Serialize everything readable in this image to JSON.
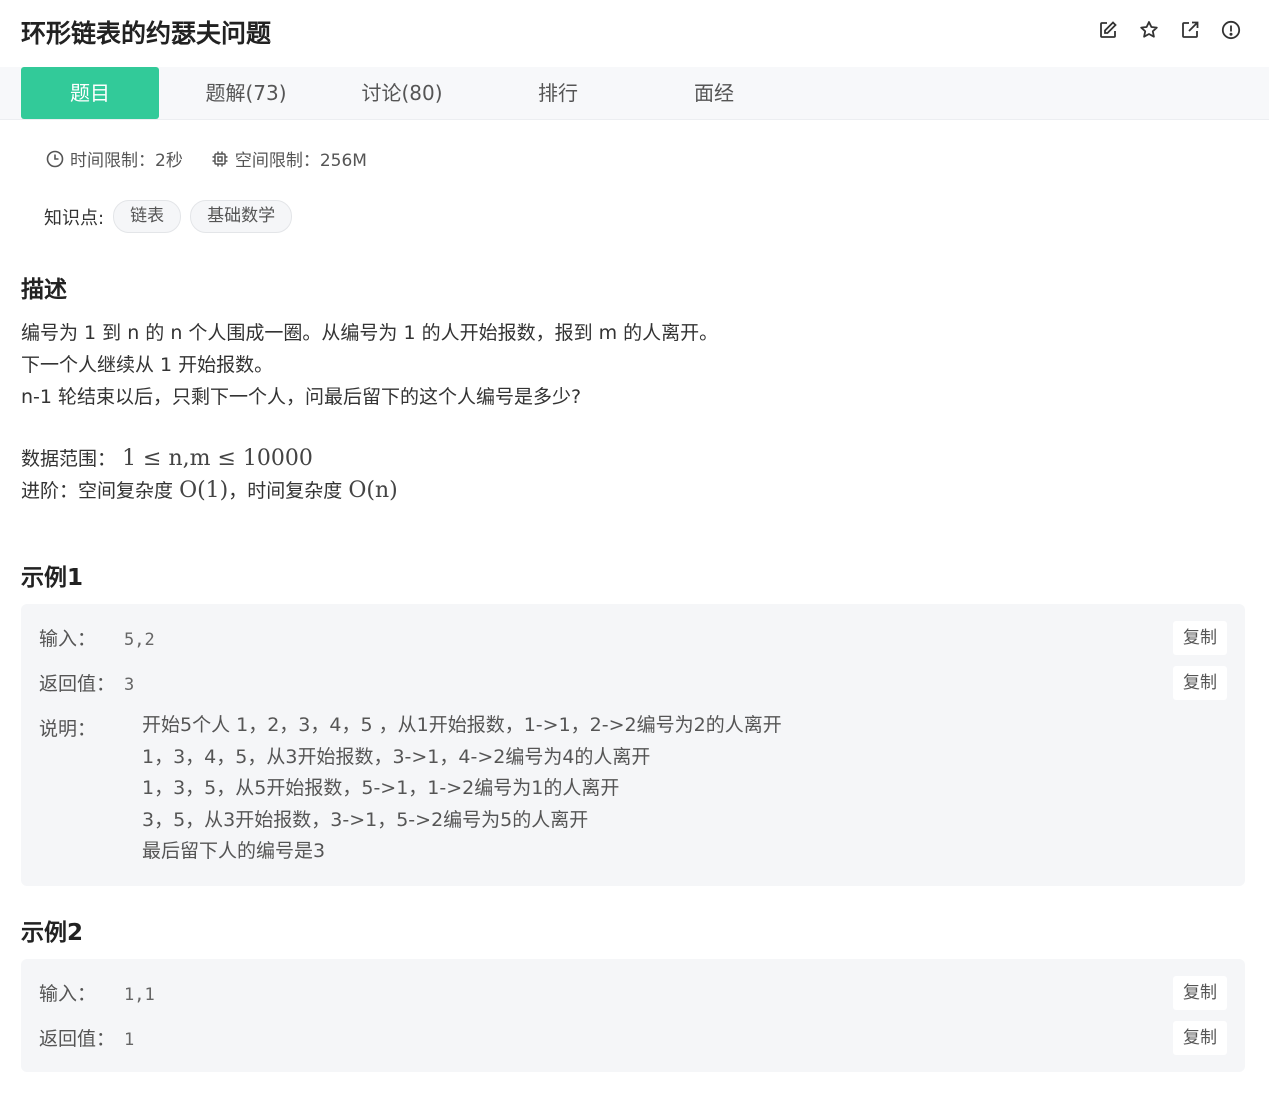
{
  "title": "环形链表的约瑟夫问题",
  "icons": [
    "edit-icon",
    "star-icon",
    "external-link-icon",
    "report-icon"
  ],
  "tabs": [
    {
      "label": "题目",
      "active": true
    },
    {
      "label": "题解(73)",
      "active": false
    },
    {
      "label": "讨论(80)",
      "active": false
    },
    {
      "label": "排行",
      "active": false
    },
    {
      "label": "面经",
      "active": false
    }
  ],
  "limits": {
    "time": "时间限制：2秒",
    "memory": "空间限制：256M"
  },
  "knowledge": {
    "label": "知识点:",
    "tags": [
      "链表",
      "基础数学"
    ]
  },
  "description": {
    "heading": "描述",
    "lines": [
      "编号为 1 到 n 的 n 个人围成一圈。从编号为 1 的人开始报数，报到 m 的人离开。",
      "下一个人继续从 1 开始报数。",
      "n-1 轮结束以后，只剩下一个人，问最后留下的这个人编号是多少?"
    ],
    "range_label": "数据范围：",
    "range_math": "1 ≤ n,m ≤ 10000",
    "advance_label": "进阶：空间复杂度",
    "advance_space": "O(1)",
    "advance_mid": "，时间复杂度",
    "advance_time": "O(n)"
  },
  "examples": [
    {
      "heading": "示例1",
      "input_label": "输入：",
      "input": "5,2",
      "return_label": "返回值：",
      "return": "3",
      "explain_label": "说明：",
      "explain": [
        "开始5个人 1，2，3，4，5 ，从1开始报数，1->1，2->2编号为2的人离开",
        "1，3，4，5，从3开始报数，3->1，4->2编号为4的人离开",
        "1，3，5，从5开始报数，5->1，1->2编号为1的人离开",
        "3，5，从3开始报数，3->1，5->2编号为5的人离开",
        "最后留下人的编号是3"
      ],
      "copy_label": "复制"
    },
    {
      "heading": "示例2",
      "input_label": "输入：",
      "input": "1,1",
      "return_label": "返回值：",
      "return": "1",
      "copy_label": "复制"
    }
  ]
}
